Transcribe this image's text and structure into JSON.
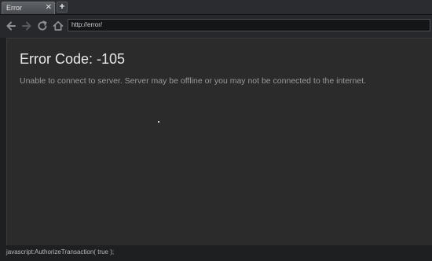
{
  "tabs": [
    {
      "label": "Error",
      "close_symbol": "✕"
    }
  ],
  "new_tab_symbol": "+",
  "toolbar": {
    "back_icon": "back-arrow-icon",
    "forward_icon": "forward-arrow-icon",
    "reload_icon": "reload-icon",
    "home_icon": "home-icon",
    "url": "http://error/"
  },
  "page": {
    "title": "Error Code: -105",
    "message": "Unable to connect to server. Server may be offline or you may not be connected to the internet."
  },
  "status_bar": {
    "text": "javascript:AuthorizeTransaction( true );"
  },
  "colors": {
    "background": "#1e1f21",
    "content_background": "#2b2b2b",
    "title_text": "#e8e8e8",
    "message_text": "#9a9a9a"
  }
}
